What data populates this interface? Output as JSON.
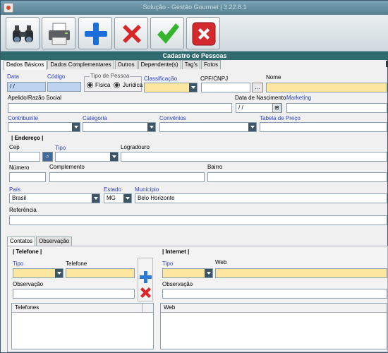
{
  "window": {
    "title": "Solução - Gestão Gourmet | 3.22.8.1"
  },
  "toolbar": {
    "buttons": [
      "search-button",
      "print-button",
      "add-button",
      "delete-button",
      "confirm-button",
      "close-button"
    ]
  },
  "section_title": "Cadastro de Pessoas",
  "tabs": [
    "Dados Básicos",
    "Dados Complementares",
    "Outros",
    "Dependente(s)",
    "Tag's",
    "Fotos"
  ],
  "basic": {
    "data_label": "Data",
    "data_value": " / /",
    "codigo_label": "Código",
    "tipo_pessoa_label": "Tipo de Pessoa",
    "fisica_label": "Física",
    "juridica_label": "Jurídica",
    "classificacao_label": "Classificação",
    "cpf_label": "CPF/CNPJ",
    "cpf_button": "...",
    "nome_label": "Nome",
    "apelido_label": "Apelido/Razão Social",
    "nascimento_label": "Data de Nascimento",
    "nascimento_value": " / /",
    "marketing_label": "Marketing",
    "contribuinte_label": "Contribuinte",
    "categoria_label": "Categoria",
    "convenios_label": "Convênios",
    "tabela_preco_label": "Tabela de Preço"
  },
  "endereco": {
    "section_label": "| Endereço |",
    "cep_label": "Cep",
    "tipo_label": "Tipo",
    "logradouro_label": "Logradouro",
    "numero_label": "Número",
    "complemento_label": "Complemento",
    "bairro_label": "Bairro",
    "pais_label": "País",
    "pais_value": "Brasil",
    "estado_label": "Estado",
    "estado_value": "MG",
    "municipio_label": "Município",
    "municipio_value": "Belo Horizonte",
    "referencia_label": "Referência"
  },
  "lower_tabs": [
    "Contatos",
    "Observação"
  ],
  "telefone": {
    "section_label": "| Telefone |",
    "tipo_label": "Tipo",
    "telefone_label": "Telefone",
    "obs_label": "Observação",
    "grid_header": "Telefones"
  },
  "internet": {
    "section_label": "| Internet |",
    "tipo_label": "Tipo",
    "web_label": "Web",
    "obs_label": "Observação",
    "grid_header": "Web"
  }
}
